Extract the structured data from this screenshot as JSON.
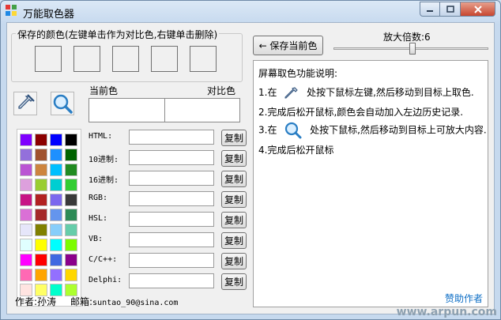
{
  "window": {
    "title": "万能取色器",
    "buttons": {
      "minimize": "minimize-icon",
      "maximize": "maximize-icon",
      "close": "close-icon"
    }
  },
  "saved_colors": {
    "group_label": "保存的颜色(左键单击作为对比色,右键单击删除)",
    "slots": [
      "",
      "",
      "",
      "",
      ""
    ]
  },
  "toolbar": {
    "save_button": "← 保存当前色",
    "zoom_label": "放大倍数:6",
    "zoom_level": 6
  },
  "preview": {
    "current_label": "当前色",
    "compare_label": "对比色"
  },
  "palette": {
    "colors": [
      "#7f00ff",
      "#8b0000",
      "#0000ff",
      "#000000",
      "#9370db",
      "#a0522d",
      "#1e90ff",
      "#006400",
      "#ba55d3",
      "#cd853f",
      "#00bfff",
      "#228b22",
      "#dda0dd",
      "#9acd32",
      "#00ced1",
      "#32cd32",
      "#c71585",
      "#b22222",
      "#7b68ee",
      "#3a3a3a",
      "#da70d6",
      "#a52a2a",
      "#6495ed",
      "#2e8b57",
      "#e6e6fa",
      "#808000",
      "#87cefa",
      "#66cdaa",
      "#e0ffff",
      "#ffff00",
      "#00ffff",
      "#7cfc00",
      "#ff00ff",
      "#ff0000",
      "#4169e1",
      "#8b008b",
      "#ff69b4",
      "#ffa500",
      "#9370ff",
      "#ffd700",
      "#ffe4e1",
      "#ffff66",
      "#00ffcc",
      "#adff2f"
    ]
  },
  "formats": [
    {
      "label": "HTML:",
      "value": "",
      "copy": "复制"
    },
    {
      "label": "10进制:",
      "value": "",
      "copy": "复制"
    },
    {
      "label": "16进制:",
      "value": "",
      "copy": "复制"
    },
    {
      "label": "RGB:",
      "value": "",
      "copy": "复制"
    },
    {
      "label": "HSL:",
      "value": "",
      "copy": "复制"
    },
    {
      "label": "VB:",
      "value": "",
      "copy": "复制"
    },
    {
      "label": "C/C++:",
      "value": "",
      "copy": "复制"
    },
    {
      "label": "Delphi:",
      "value": "",
      "copy": "复制"
    }
  ],
  "instructions": {
    "title": "屏幕取色功能说明:",
    "step1_prefix": "1.在",
    "step1_suffix": "处按下鼠标左键,然后移动到目标上取色.",
    "step2": "2.完成后松开鼠标,颜色会自动加入左边历史记录.",
    "step3_prefix": "3.在",
    "step3_suffix": "处按下鼠标,然后移动到目标上可放大内容.",
    "step4": "4.完成后松开鼠标"
  },
  "footer": {
    "author": "作者:孙涛",
    "email_label": "邮箱:",
    "email": "suntao_90@sina.com",
    "sponsor_link": "赞助作者",
    "watermark": "www.arpun.com"
  },
  "icons": {
    "eyedropper": "eyedropper-icon",
    "magnifier": "magnifier-icon"
  }
}
